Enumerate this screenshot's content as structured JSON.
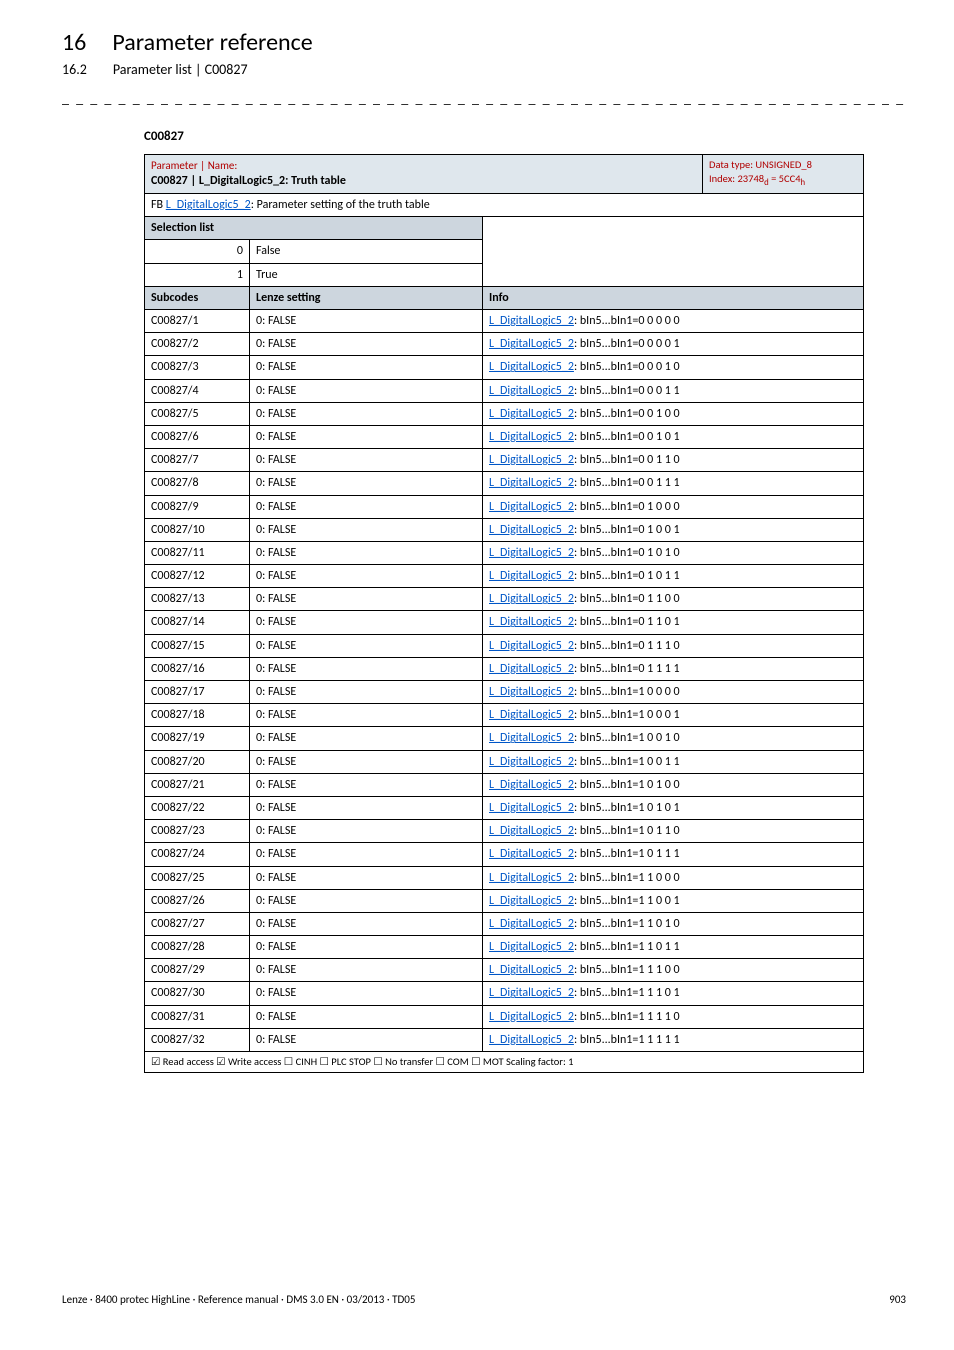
{
  "header": {
    "chapter_num": "16",
    "chapter_title": "Parameter reference",
    "section_num": "16.2",
    "section_title": "Parameter list | C00827"
  },
  "dash_rule": "_ _ _ _ _ _ _ _ _ _ _ _ _ _ _ _ _ _ _ _ _ _ _ _ _ _ _ _ _ _ _ _ _ _ _ _ _ _ _ _ _ _ _ _ _ _ _ _ _ _ _ _ _ _ _ _ _ _ _ _ _ _ _ _",
  "param_code": "C00827",
  "table_header": {
    "param_label": "Parameter | Name:",
    "param_main": "C00827 | L_DigitalLogic5_2: Truth table",
    "datatype_line1": "Data type: UNSIGNED_8",
    "datatype_line2": "Index: 23748",
    "datatype_sub": "d",
    "datatype_eq": " = 5CC4",
    "datatype_sub2": "h"
  },
  "fb_row": {
    "prefix": "FB ",
    "link": "L_DigitalLogic5_2",
    "suffix": ": Parameter setting of the truth table"
  },
  "selection_header": "Selection list",
  "selection_rows": [
    {
      "num": "0",
      "label": "False"
    },
    {
      "num": "1",
      "label": "True"
    }
  ],
  "subcodes_header": {
    "left": "Subcodes",
    "mid": "Lenze setting",
    "right": "Info"
  },
  "info_link_text": "L_DigitalLogic5_2",
  "rows": [
    {
      "sub": "C00827/1",
      "setting": "0: FALSE",
      "bits": "0 0 0 0 0"
    },
    {
      "sub": "C00827/2",
      "setting": "0: FALSE",
      "bits": "0 0 0 0 1"
    },
    {
      "sub": "C00827/3",
      "setting": "0: FALSE",
      "bits": "0 0 0 1 0"
    },
    {
      "sub": "C00827/4",
      "setting": "0: FALSE",
      "bits": "0 0 0 1 1"
    },
    {
      "sub": "C00827/5",
      "setting": "0: FALSE",
      "bits": "0 0 1 0 0"
    },
    {
      "sub": "C00827/6",
      "setting": "0: FALSE",
      "bits": "0 0 1 0 1"
    },
    {
      "sub": "C00827/7",
      "setting": "0: FALSE",
      "bits": "0 0 1 1 0"
    },
    {
      "sub": "C00827/8",
      "setting": "0: FALSE",
      "bits": "0 0 1 1 1"
    },
    {
      "sub": "C00827/9",
      "setting": "0: FALSE",
      "bits": "0 1 0 0 0"
    },
    {
      "sub": "C00827/10",
      "setting": "0: FALSE",
      "bits": "0 1 0 0 1"
    },
    {
      "sub": "C00827/11",
      "setting": "0: FALSE",
      "bits": "0 1 0 1 0"
    },
    {
      "sub": "C00827/12",
      "setting": "0: FALSE",
      "bits": "0 1 0 1 1"
    },
    {
      "sub": "C00827/13",
      "setting": "0: FALSE",
      "bits": "0 1 1 0 0"
    },
    {
      "sub": "C00827/14",
      "setting": "0: FALSE",
      "bits": "0 1 1 0 1"
    },
    {
      "sub": "C00827/15",
      "setting": "0: FALSE",
      "bits": "0 1 1 1 0"
    },
    {
      "sub": "C00827/16",
      "setting": "0: FALSE",
      "bits": "0 1 1 1 1"
    },
    {
      "sub": "C00827/17",
      "setting": "0: FALSE",
      "bits": "1 0 0 0 0"
    },
    {
      "sub": "C00827/18",
      "setting": "0: FALSE",
      "bits": "1 0 0 0 1"
    },
    {
      "sub": "C00827/19",
      "setting": "0: FALSE",
      "bits": "1 0 0 1 0"
    },
    {
      "sub": "C00827/20",
      "setting": "0: FALSE",
      "bits": "1 0 0 1 1"
    },
    {
      "sub": "C00827/21",
      "setting": "0: FALSE",
      "bits": "1 0 1 0 0"
    },
    {
      "sub": "C00827/22",
      "setting": "0: FALSE",
      "bits": "1 0 1 0 1"
    },
    {
      "sub": "C00827/23",
      "setting": "0: FALSE",
      "bits": "1 0 1 1 0"
    },
    {
      "sub": "C00827/24",
      "setting": "0: FALSE",
      "bits": "1 0 1 1 1"
    },
    {
      "sub": "C00827/25",
      "setting": "0: FALSE",
      "bits": "1 1 0 0 0"
    },
    {
      "sub": "C00827/26",
      "setting": "0: FALSE",
      "bits": "1 1 0 0 1"
    },
    {
      "sub": "C00827/27",
      "setting": "0: FALSE",
      "bits": "1 1 0 1 0"
    },
    {
      "sub": "C00827/28",
      "setting": "0: FALSE",
      "bits": "1 1 0 1 1"
    },
    {
      "sub": "C00827/29",
      "setting": "0: FALSE",
      "bits": "1 1 1 0 0"
    },
    {
      "sub": "C00827/30",
      "setting": "0: FALSE",
      "bits": "1 1 1 0 1"
    },
    {
      "sub": "C00827/31",
      "setting": "0: FALSE",
      "bits": "1 1 1 1 0"
    },
    {
      "sub": "C00827/32",
      "setting": "0: FALSE",
      "bits": "1 1 1 1 1"
    }
  ],
  "footer_row": "☑ Read access   ☑ Write access   ☐ CINH   ☐ PLC STOP   ☐ No transfer   ☐ COM   ☐ MOT    Scaling factor: 1",
  "page_footer": {
    "left": "Lenze · 8400 protec HighLine · Reference manual · DMS 3.0 EN · 03/2013 · TD05",
    "right": "903"
  }
}
